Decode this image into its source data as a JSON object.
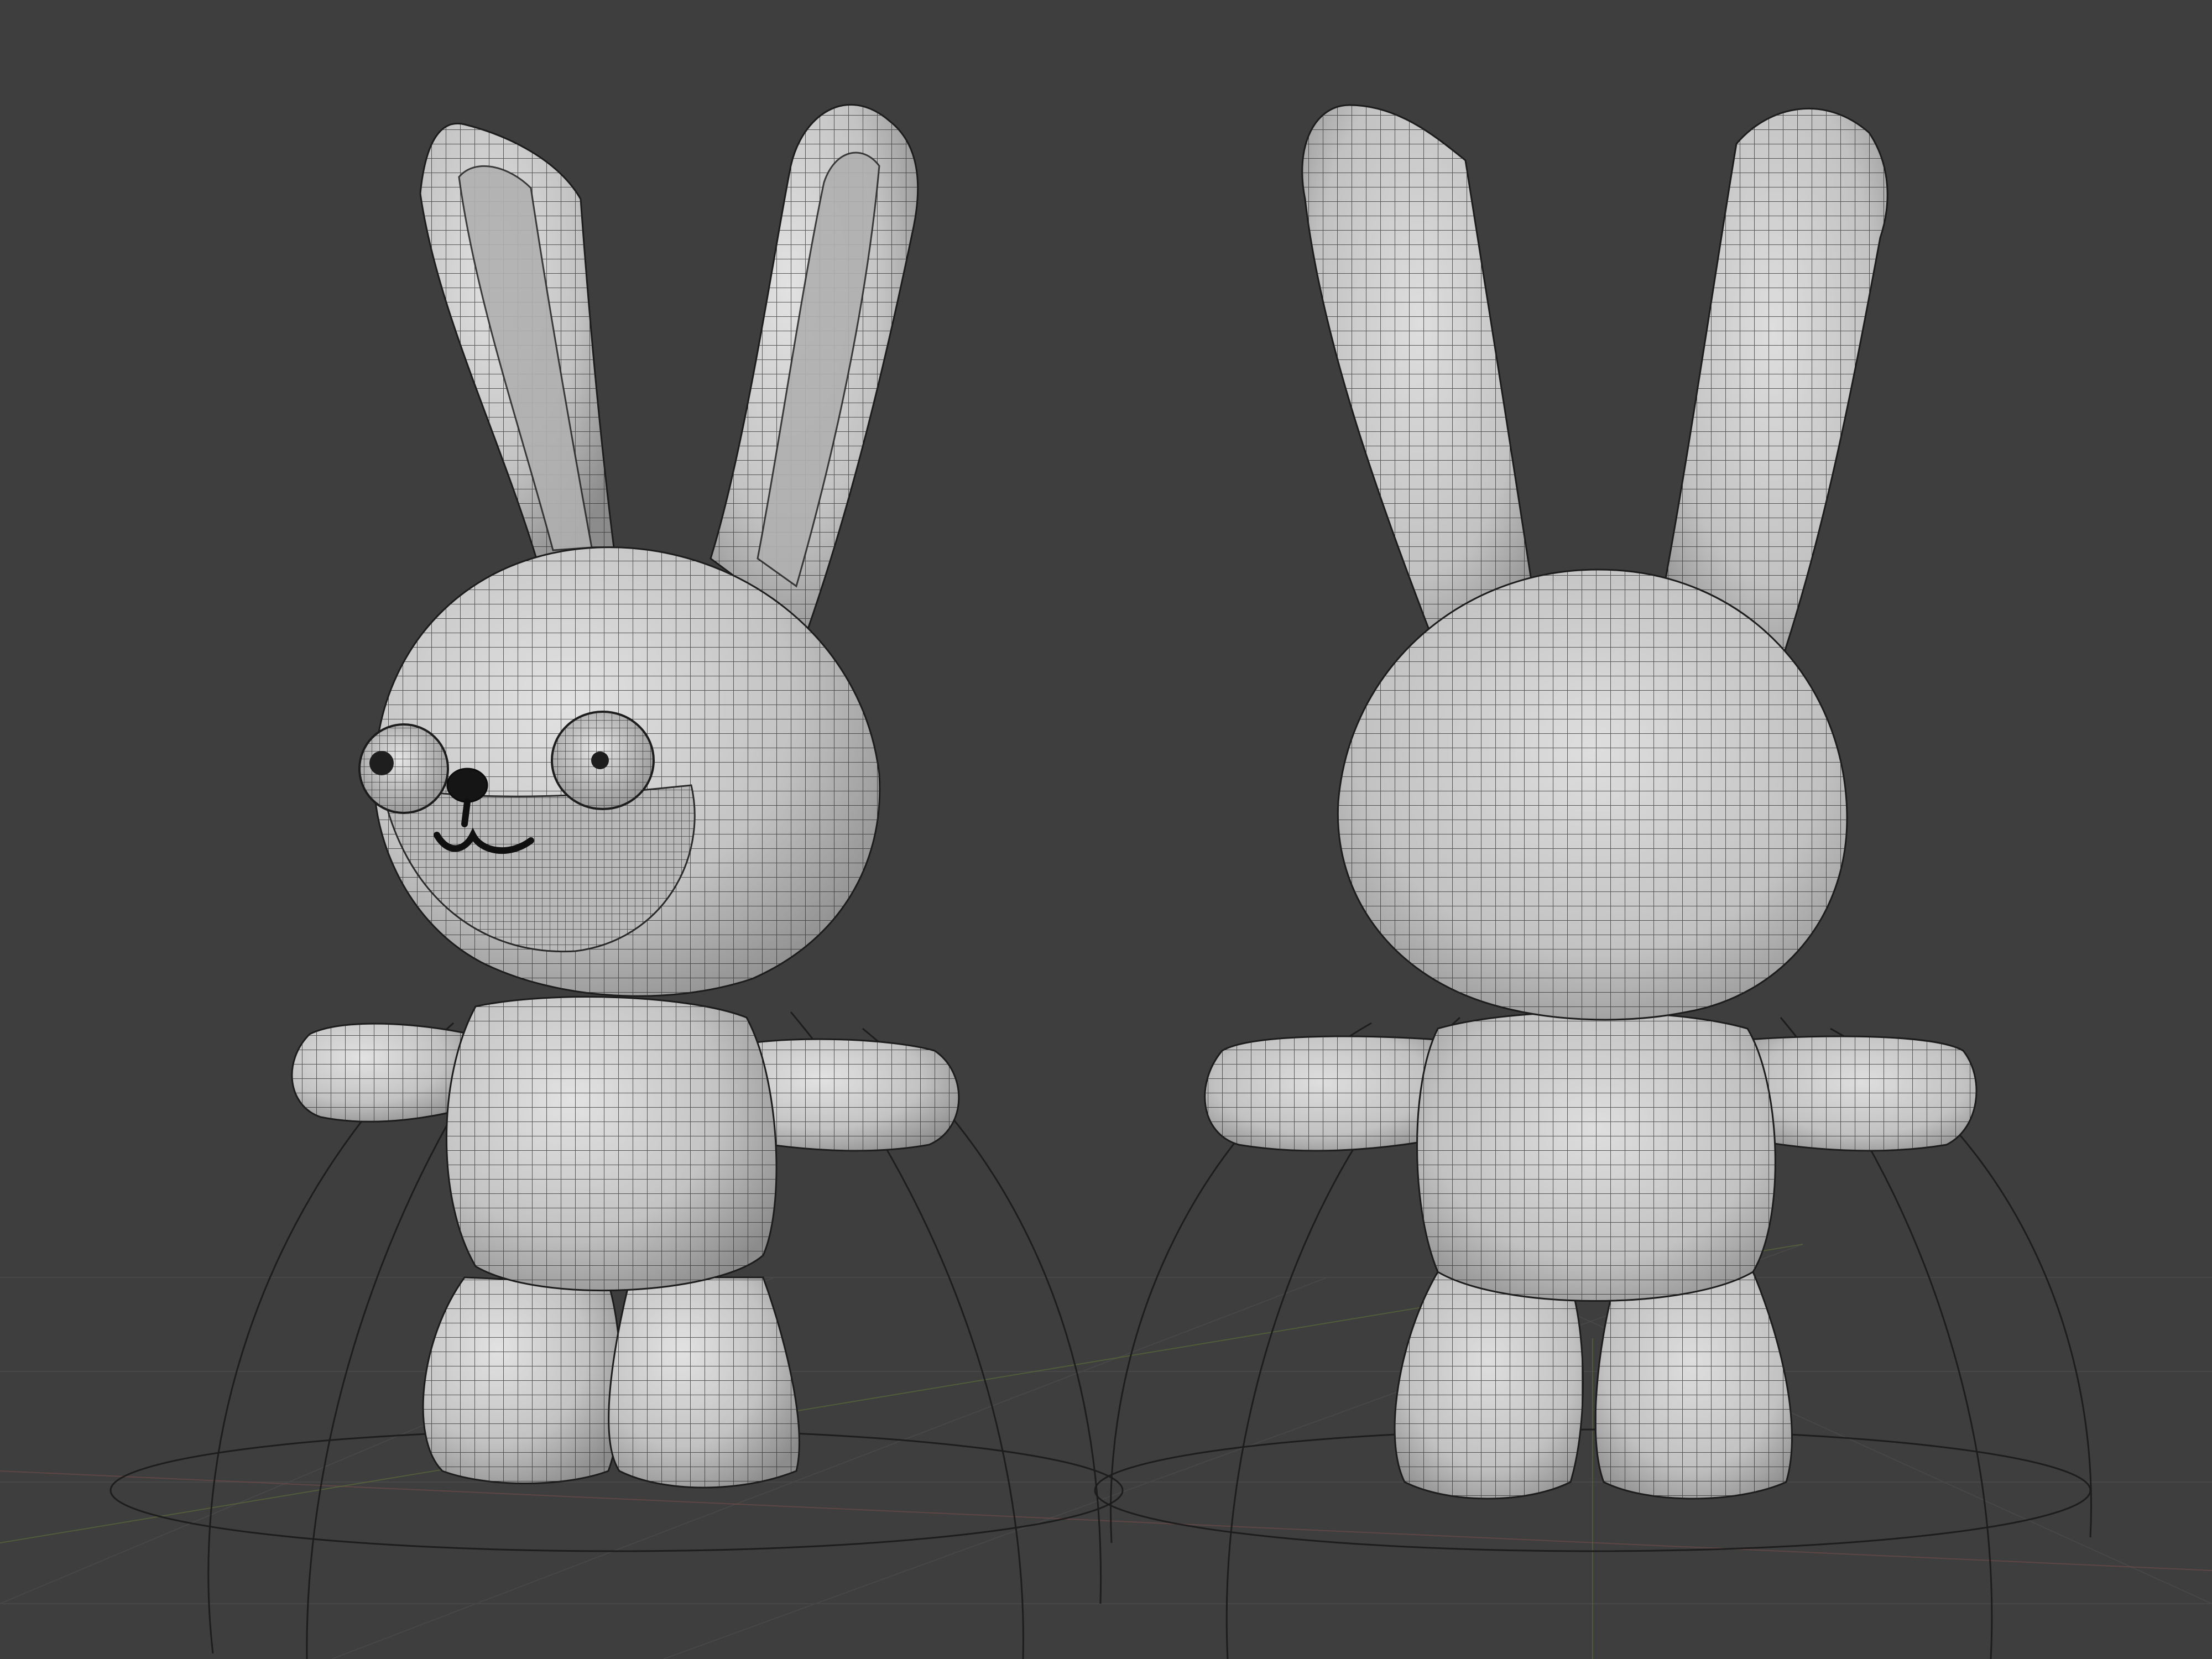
{
  "viewport": {
    "background": "#3e3e3e",
    "grid_line_color": "#474747",
    "mesh_wire_color": "#2a2a2a",
    "mesh_surface_color": "#c9c9c9"
  },
  "models": [
    {
      "id": "bunny-front",
      "view": "front-three-quarter"
    },
    {
      "id": "bunny-back",
      "view": "back"
    }
  ]
}
